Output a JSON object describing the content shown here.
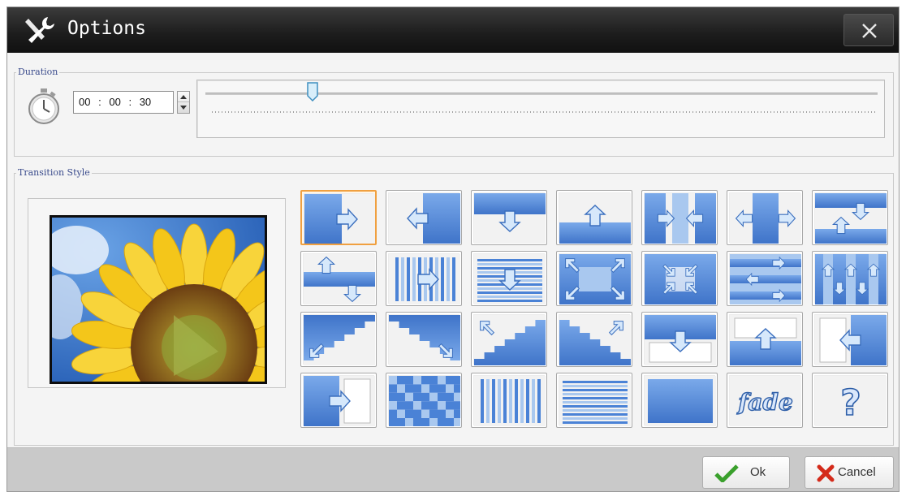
{
  "window": {
    "title": "Options"
  },
  "icons": {
    "title": "tools-icon",
    "close": "close-icon",
    "duration": "stopwatch-icon",
    "ok": "checkmark-icon",
    "cancel": "cross-icon"
  },
  "duration": {
    "label": "Duration",
    "hours": "00",
    "minutes": "00",
    "seconds": "30",
    "separator": ":",
    "slider_fraction": 0.16
  },
  "transition": {
    "label": "Transition Style",
    "selected_index": 0,
    "tiles": [
      {
        "name": "push-right"
      },
      {
        "name": "push-left"
      },
      {
        "name": "push-down"
      },
      {
        "name": "push-up"
      },
      {
        "name": "split-in-horizontal"
      },
      {
        "name": "split-out-horizontal"
      },
      {
        "name": "split-vertical"
      },
      {
        "name": "split-horizontal"
      },
      {
        "name": "blinds-right"
      },
      {
        "name": "blinds-down"
      },
      {
        "name": "box-out"
      },
      {
        "name": "box-in"
      },
      {
        "name": "comb-horizontal"
      },
      {
        "name": "comb-vertical"
      },
      {
        "name": "stairs-down-left"
      },
      {
        "name": "stairs-down-right"
      },
      {
        "name": "stairs-up-left"
      },
      {
        "name": "stairs-up-right"
      },
      {
        "name": "cover-down"
      },
      {
        "name": "cover-up"
      },
      {
        "name": "cover-left"
      },
      {
        "name": "cover-right"
      },
      {
        "name": "dissolve"
      },
      {
        "name": "bars-vertical"
      },
      {
        "name": "bars-horizontal"
      },
      {
        "name": "cut"
      },
      {
        "name": "fade",
        "label": "fade"
      },
      {
        "name": "random",
        "label": "?"
      }
    ]
  },
  "buttons": {
    "ok": "Ok",
    "cancel": "Cancel"
  },
  "colors": {
    "tile_blue": "#4a82d6",
    "tile_light": "#a9c8ef",
    "selected_border": "#f0a040",
    "ok_green": "#3aa02c",
    "cancel_red": "#d42a1a"
  }
}
